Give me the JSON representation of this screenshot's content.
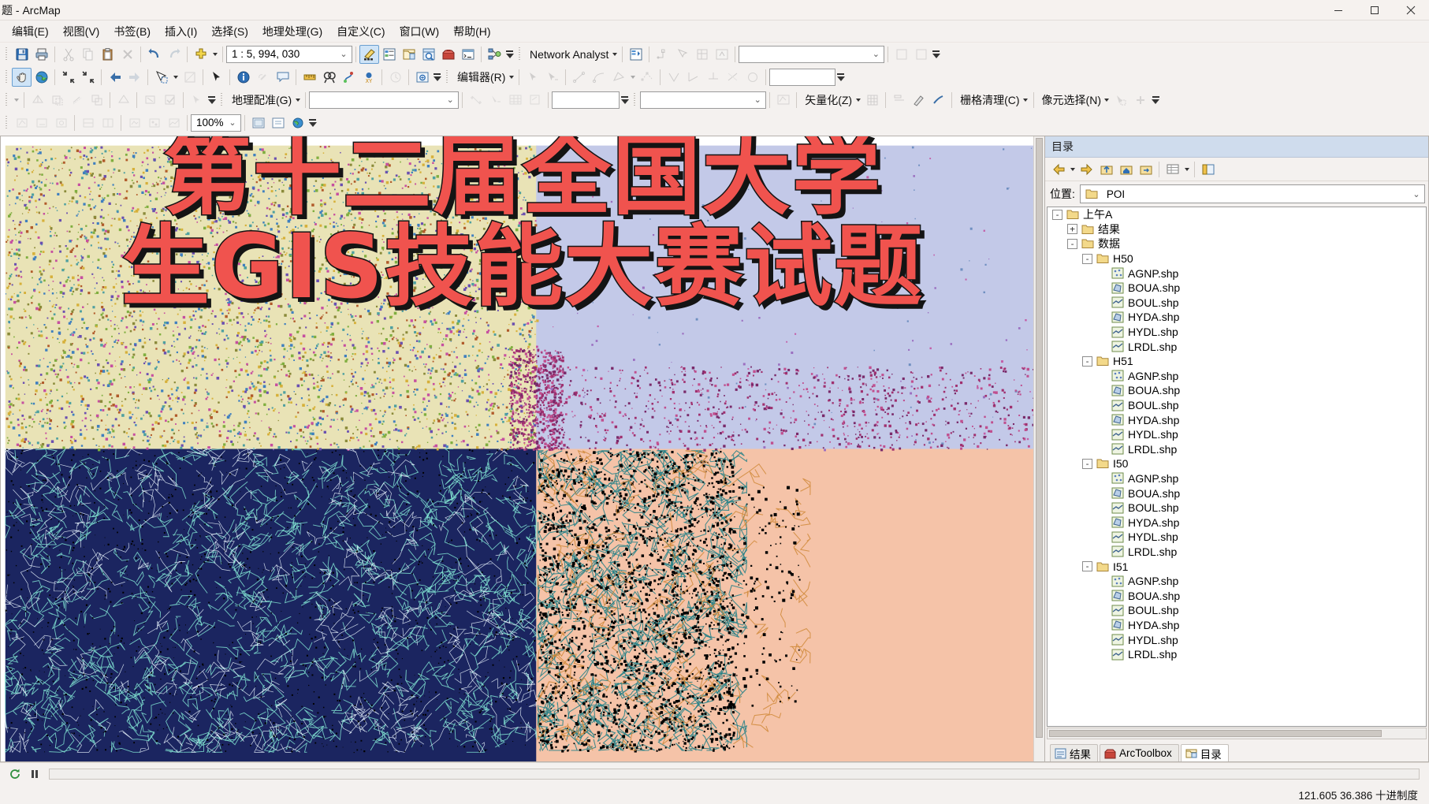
{
  "window": {
    "title": "题 - ArcMap",
    "controls": {
      "minimize": "minimize-icon",
      "maximize": "maximize-icon",
      "close": "close-icon"
    }
  },
  "menu": [
    {
      "label": "编辑(E)",
      "name": "menu-edit"
    },
    {
      "label": "视图(V)",
      "name": "menu-view"
    },
    {
      "label": "书签(B)",
      "name": "menu-bookmarks"
    },
    {
      "label": "插入(I)",
      "name": "menu-insert"
    },
    {
      "label": "选择(S)",
      "name": "menu-selection"
    },
    {
      "label": "地理处理(G)",
      "name": "menu-geoprocessing"
    },
    {
      "label": "自定义(C)",
      "name": "menu-customize"
    },
    {
      "label": "窗口(W)",
      "name": "menu-window"
    },
    {
      "label": "帮助(H)",
      "name": "menu-help"
    }
  ],
  "toolbars": {
    "standard": {
      "scale_value": "1 : 5, 994, 030",
      "scale_placeholder": "1:5,994,030"
    },
    "network_analyst": {
      "label": "Network Analyst",
      "dropdown_value": ""
    },
    "editor": {
      "label": "编辑器(R)"
    },
    "georeferencing": {
      "label": "地理配准(G)",
      "combo_value": ""
    },
    "vectorization": {
      "label": "矢量化(Z)"
    },
    "raster_cleanup": {
      "label": "栅格清理(C)"
    },
    "pixel_select": {
      "label": "像元选择(N)"
    },
    "image_analysis": {
      "zoom_value": "100%"
    },
    "misc_combo": {
      "value": ""
    }
  },
  "map": {
    "banner_line1": "第十二届全国大学",
    "banner_line2": "生GIS技能大赛试题",
    "banner_color": "#f0534e",
    "banner_outline": "#141414"
  },
  "catalog": {
    "title": "目录",
    "location_label": "位置:",
    "location_value": "POI",
    "toolbar_buttons": [
      "back-icon",
      "forward-icon",
      "up-one-level-icon",
      "home-icon",
      "connect-folder-icon",
      "view-type-icon",
      "toggle-contents-icon"
    ],
    "tree": [
      {
        "label": "上午A",
        "indent": 0,
        "toggle": "-",
        "icon": "folder-icon"
      },
      {
        "label": "结果",
        "indent": 1,
        "toggle": "+",
        "icon": "folder-icon"
      },
      {
        "label": "数据",
        "indent": 1,
        "toggle": "-",
        "icon": "folder-icon"
      },
      {
        "label": "H50",
        "indent": 2,
        "toggle": "-",
        "icon": "folder-icon"
      },
      {
        "label": "AGNP.shp",
        "indent": 3,
        "toggle": "",
        "icon": "point-shapefile-icon"
      },
      {
        "label": "BOUA.shp",
        "indent": 3,
        "toggle": "",
        "icon": "polygon-shapefile-icon"
      },
      {
        "label": "BOUL.shp",
        "indent": 3,
        "toggle": "",
        "icon": "line-shapefile-icon"
      },
      {
        "label": "HYDA.shp",
        "indent": 3,
        "toggle": "",
        "icon": "polygon-shapefile-icon"
      },
      {
        "label": "HYDL.shp",
        "indent": 3,
        "toggle": "",
        "icon": "line-shapefile-icon"
      },
      {
        "label": "LRDL.shp",
        "indent": 3,
        "toggle": "",
        "icon": "line-shapefile-icon"
      },
      {
        "label": "H51",
        "indent": 2,
        "toggle": "-",
        "icon": "folder-icon"
      },
      {
        "label": "AGNP.shp",
        "indent": 3,
        "toggle": "",
        "icon": "point-shapefile-icon"
      },
      {
        "label": "BOUA.shp",
        "indent": 3,
        "toggle": "",
        "icon": "polygon-shapefile-icon"
      },
      {
        "label": "BOUL.shp",
        "indent": 3,
        "toggle": "",
        "icon": "line-shapefile-icon"
      },
      {
        "label": "HYDA.shp",
        "indent": 3,
        "toggle": "",
        "icon": "polygon-shapefile-icon"
      },
      {
        "label": "HYDL.shp",
        "indent": 3,
        "toggle": "",
        "icon": "line-shapefile-icon"
      },
      {
        "label": "LRDL.shp",
        "indent": 3,
        "toggle": "",
        "icon": "line-shapefile-icon"
      },
      {
        "label": "I50",
        "indent": 2,
        "toggle": "-",
        "icon": "folder-icon"
      },
      {
        "label": "AGNP.shp",
        "indent": 3,
        "toggle": "",
        "icon": "point-shapefile-icon"
      },
      {
        "label": "BOUA.shp",
        "indent": 3,
        "toggle": "",
        "icon": "polygon-shapefile-icon"
      },
      {
        "label": "BOUL.shp",
        "indent": 3,
        "toggle": "",
        "icon": "line-shapefile-icon"
      },
      {
        "label": "HYDA.shp",
        "indent": 3,
        "toggle": "",
        "icon": "polygon-shapefile-icon"
      },
      {
        "label": "HYDL.shp",
        "indent": 3,
        "toggle": "",
        "icon": "line-shapefile-icon"
      },
      {
        "label": "LRDL.shp",
        "indent": 3,
        "toggle": "",
        "icon": "line-shapefile-icon"
      },
      {
        "label": "I51",
        "indent": 2,
        "toggle": "-",
        "icon": "folder-icon"
      },
      {
        "label": "AGNP.shp",
        "indent": 3,
        "toggle": "",
        "icon": "point-shapefile-icon"
      },
      {
        "label": "BOUA.shp",
        "indent": 3,
        "toggle": "",
        "icon": "polygon-shapefile-icon"
      },
      {
        "label": "BOUL.shp",
        "indent": 3,
        "toggle": "",
        "icon": "line-shapefile-icon"
      },
      {
        "label": "HYDA.shp",
        "indent": 3,
        "toggle": "",
        "icon": "polygon-shapefile-icon"
      },
      {
        "label": "HYDL.shp",
        "indent": 3,
        "toggle": "",
        "icon": "line-shapefile-icon"
      },
      {
        "label": "LRDL.shp",
        "indent": 3,
        "toggle": "",
        "icon": "line-shapefile-icon"
      }
    ],
    "tabs": [
      {
        "label": "结果",
        "name": "tab-results",
        "icon": "results-icon",
        "selected": false
      },
      {
        "label": "ArcToolbox",
        "name": "tab-arctoolbox",
        "icon": "toolbox-icon",
        "selected": false
      },
      {
        "label": "目录",
        "name": "tab-catalog",
        "icon": "catalog-icon",
        "selected": true
      }
    ]
  },
  "status": {
    "coordinates": "121.605  36.386  十进制度",
    "refresh_icon": "refresh-icon",
    "pause_icon": "pause-icon"
  }
}
